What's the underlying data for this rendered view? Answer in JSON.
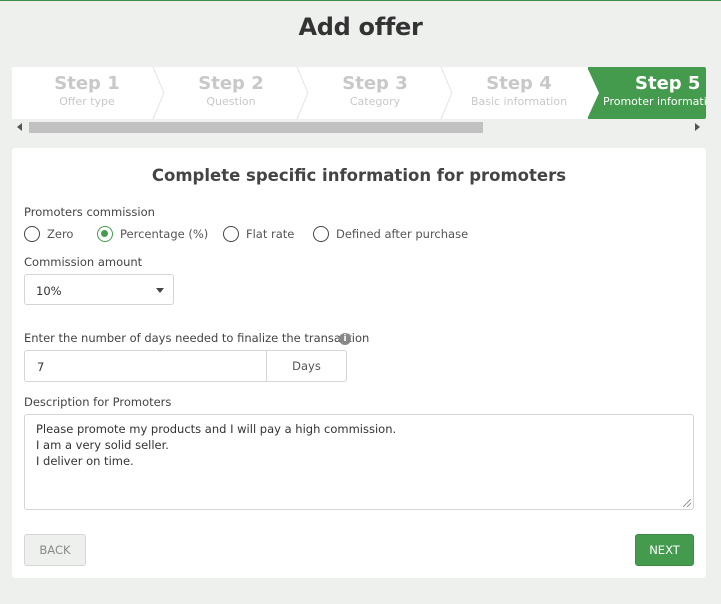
{
  "page": {
    "title": "Add offer"
  },
  "stepper": {
    "steps": [
      {
        "number": "Step 1",
        "label": "Offer type",
        "active": false
      },
      {
        "number": "Step 2",
        "label": "Question",
        "active": false
      },
      {
        "number": "Step 3",
        "label": "Category",
        "active": false
      },
      {
        "number": "Step 4",
        "label": "Basic information",
        "active": false
      },
      {
        "number": "Step 5",
        "label": "Promoter information",
        "active": true
      }
    ]
  },
  "form": {
    "title": "Complete specific information for promoters",
    "commission": {
      "label": "Promoters commission",
      "options": [
        "Zero",
        "Percentage (%)",
        "Flat rate",
        "Defined after purchase"
      ],
      "selected": "Percentage (%)"
    },
    "amount": {
      "label": "Commission amount",
      "value": "10%"
    },
    "days": {
      "label": "Enter the number of days needed to finalize the transaction",
      "value": "7",
      "unit": "Days",
      "info_icon": "info-icon"
    },
    "description": {
      "label": "Description for Promoters",
      "lines": [
        "Please promote my products and I will pay a high commission.",
        "I am a very solid seller.",
        "I deliver on time."
      ]
    },
    "buttons": {
      "back": "BACK",
      "next": "NEXT"
    }
  },
  "colors": {
    "accent": "#449b4e",
    "background": "#eef0ee"
  }
}
